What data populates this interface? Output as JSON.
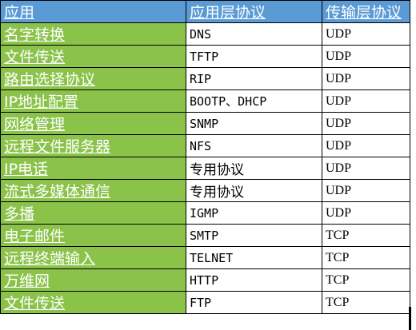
{
  "table": {
    "headers": [
      "应用",
      "应用层协议",
      "传输层协议"
    ],
    "rows": [
      {
        "app": "名字转换",
        "app_protocol": "DNS",
        "transport": "UDP"
      },
      {
        "app": "文件传送",
        "app_protocol": "TFTP",
        "transport": "UDP"
      },
      {
        "app": "路由选择协议",
        "app_protocol": "RIP",
        "transport": "UDP"
      },
      {
        "app": "IP地址配置",
        "app_protocol": "BOOTP、DHCP",
        "transport": "UDP"
      },
      {
        "app": "网络管理",
        "app_protocol": "SNMP",
        "transport": "UDP"
      },
      {
        "app": "远程文件服务器",
        "app_protocol": "NFS",
        "transport": "UDP"
      },
      {
        "app": "IP电话",
        "app_protocol": "专用协议",
        "transport": "UDP"
      },
      {
        "app": "流式多媒体通信",
        "app_protocol": "专用协议",
        "transport": "UDP"
      },
      {
        "app": "多播",
        "app_protocol": "IGMP",
        "transport": "UDP"
      },
      {
        "app": "电子邮件",
        "app_protocol": "SMTP",
        "transport": "TCP"
      },
      {
        "app": "远程终端输入",
        "app_protocol": "TELNET",
        "transport": "TCP"
      },
      {
        "app": "万维网",
        "app_protocol": "HTTP",
        "transport": "TCP"
      },
      {
        "app": "文件传送",
        "app_protocol": "FTP",
        "transport": "TCP"
      }
    ]
  },
  "colors": {
    "header_bg": "#5b9bd5",
    "app_column_bg": "#8bc34a",
    "cell_bg": "#ffffff",
    "border": "#000000"
  }
}
